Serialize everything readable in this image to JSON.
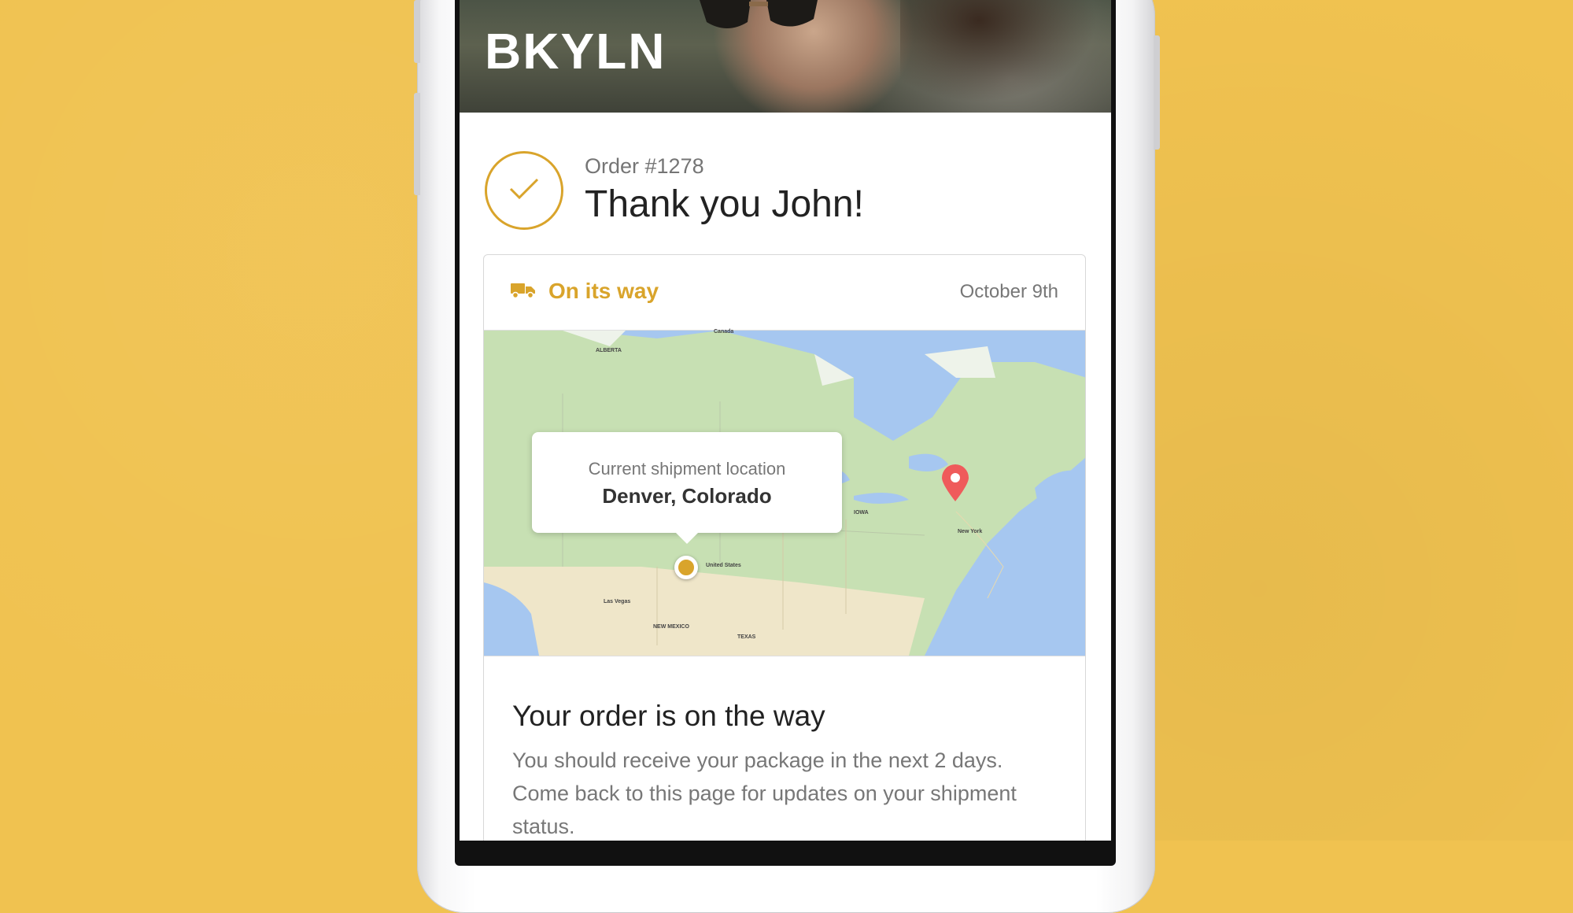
{
  "brand": "BKYLN",
  "order": {
    "number": "Order #1278",
    "thanks": "Thank you John!"
  },
  "shipment": {
    "status": "On its way",
    "date": "October 9th",
    "tooltip_label": "Current shipment location",
    "current_location": "Denver, Colorado"
  },
  "map_labels": {
    "canada": "Canada",
    "alberta": "ALBERTA",
    "us": "United States",
    "las_vegas": "Las Vegas",
    "new_mexico": "NEW MEXICO",
    "texas": "TEXAS",
    "ny": "New York",
    "iowa": "IOWA"
  },
  "message": {
    "title": "Your order is on the way",
    "text": "You should receive your package in the next 2 days. Come back to this page for updates on your shipment status."
  },
  "colors": {
    "background": "#f0c250",
    "accent": "#d9a42b",
    "pin": "#ef5b5b"
  },
  "icons": [
    "check-icon",
    "truck-icon",
    "location-dot-icon",
    "map-pin-icon"
  ]
}
